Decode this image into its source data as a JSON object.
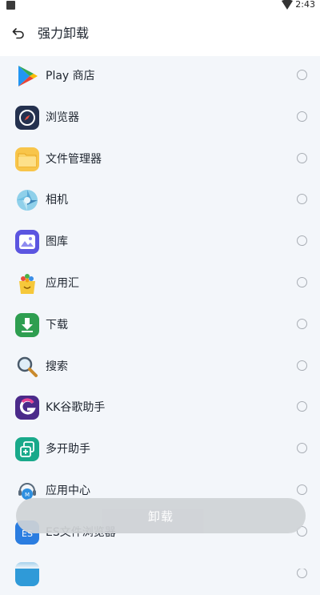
{
  "status_bar": {
    "time": "2:43"
  },
  "header": {
    "title": "强力卸载"
  },
  "apps": [
    {
      "label": "Play 商店",
      "icon": "play-store-icon",
      "color": "#34a853"
    },
    {
      "label": "浏览器",
      "icon": "browser-compass-icon",
      "color": "#24314f"
    },
    {
      "label": "文件管理器",
      "icon": "folder-icon",
      "color": "#f8c54a"
    },
    {
      "label": "相机",
      "icon": "camera-aperture-icon",
      "color": "#7fc7e6"
    },
    {
      "label": "图库",
      "icon": "gallery-icon",
      "color": "#5b55e0"
    },
    {
      "label": "应用汇",
      "icon": "appchina-icon",
      "color": "#f6c83a"
    },
    {
      "label": "下载",
      "icon": "download-icon",
      "color": "#2e9e50"
    },
    {
      "label": "搜索",
      "icon": "magnifier-icon",
      "color": "#6b7c8f"
    },
    {
      "label": "KK谷歌助手",
      "icon": "kk-google-icon",
      "color": "#4b2a8a"
    },
    {
      "label": "多开助手",
      "icon": "multi-open-icon",
      "color": "#19a98a"
    },
    {
      "label": "应用中心",
      "icon": "app-center-icon",
      "color": "#2d8fe0"
    },
    {
      "label": "ES文件浏览器",
      "icon": "es-file-explorer-icon",
      "color": "#2b7de0"
    },
    {
      "label": "",
      "icon": "app-icon",
      "color": "#2f9ad8"
    }
  ],
  "footer": {
    "button_label": "卸载"
  }
}
